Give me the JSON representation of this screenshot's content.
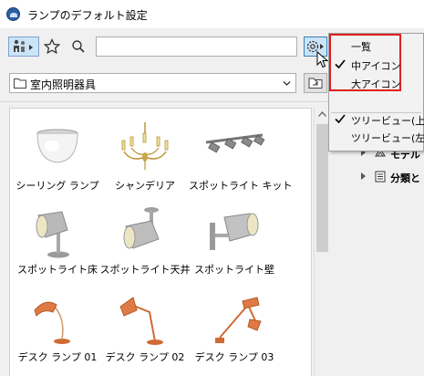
{
  "window": {
    "title": "ランプのデフォルト設定"
  },
  "toolbar": {
    "people_icon": "people-filter-icon",
    "star_icon": "favorites-star-icon",
    "search_icon": "search-icon",
    "search": {
      "value": "",
      "placeholder": ""
    },
    "gear_icon": "gear-settings-icon"
  },
  "folder": {
    "label": "室内照明器具"
  },
  "grid": {
    "items": [
      {
        "label": "シーリング ランプ",
        "icon": "ceiling-lamp-icon"
      },
      {
        "label": "シャンデリア",
        "icon": "chandelier-icon"
      },
      {
        "label": "スポットライト キット",
        "icon": "spotlight-kit-icon"
      },
      {
        "label": "スポットライト床",
        "icon": "floor-spotlight-icon"
      },
      {
        "label": "スポットライト天井",
        "icon": "ceiling-spotlight-icon"
      },
      {
        "label": "スポットライト壁",
        "icon": "wall-spotlight-icon"
      },
      {
        "label": "デスク ランプ 01",
        "icon": "desk-lamp-icon"
      },
      {
        "label": "デスク ランプ 02",
        "icon": "desk-lamp-icon"
      },
      {
        "label": "デスク ランプ 03",
        "icon": "desk-lamp-icon"
      }
    ]
  },
  "menu": {
    "items": [
      {
        "label": "一覧",
        "checked": false
      },
      {
        "label": "中アイコン",
        "checked": true
      },
      {
        "label": "大アイコン",
        "checked": false
      },
      {
        "label": "ツリービュー(上)",
        "checked": true
      },
      {
        "label": "ツリービュー(左)",
        "checked": false
      }
    ]
  },
  "tree": {
    "items": [
      {
        "label": "モデル",
        "icon": "model-icon"
      },
      {
        "label": "分類と",
        "icon": "classification-icon"
      }
    ]
  },
  "colors": {
    "accent": "#cce4f7",
    "highlight": "#e02020",
    "lamp_orange": "#e07a45"
  }
}
